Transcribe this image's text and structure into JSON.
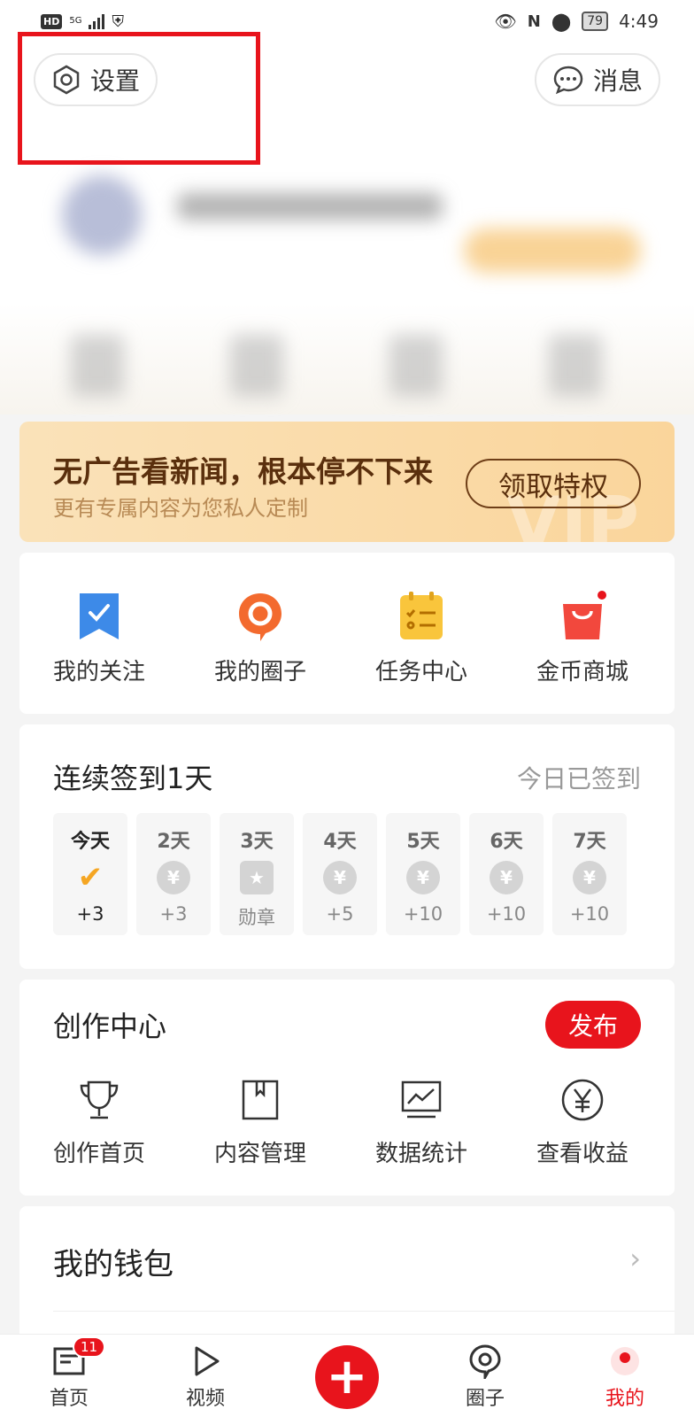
{
  "status_bar": {
    "left_badge": "HD",
    "network": "5G",
    "battery": "79",
    "time": "4:49"
  },
  "header": {
    "settings_label": "设置",
    "messages_label": "消息"
  },
  "vip_banner": {
    "title": "无广告看新闻，根本停不下来",
    "subtitle": "更有专属内容为您私人定制",
    "button": "领取特权",
    "watermark": "VIP"
  },
  "quick_actions": [
    {
      "label": "我的关注",
      "icon": "bookmark-icon"
    },
    {
      "label": "我的圈子",
      "icon": "circle-chat-icon"
    },
    {
      "label": "任务中心",
      "icon": "task-clipboard-icon"
    },
    {
      "label": "金币商城",
      "icon": "shopping-bag-icon"
    }
  ],
  "signin": {
    "title": "连续签到1天",
    "status": "今日已签到",
    "days": [
      {
        "label": "今天",
        "reward": "+3",
        "icon": "check-icon"
      },
      {
        "label": "2天",
        "reward": "+3",
        "icon": "coin-icon"
      },
      {
        "label": "3天",
        "reward": "勋章",
        "icon": "medal-icon"
      },
      {
        "label": "4天",
        "reward": "+5",
        "icon": "coin-icon"
      },
      {
        "label": "5天",
        "reward": "+10",
        "icon": "coin-icon"
      },
      {
        "label": "6天",
        "reward": "+10",
        "icon": "coin-icon"
      },
      {
        "label": "7天",
        "reward": "+10",
        "icon": "coin-icon"
      }
    ]
  },
  "creation": {
    "title": "创作中心",
    "publish": "发布",
    "items": [
      {
        "label": "创作首页",
        "icon": "trophy-icon"
      },
      {
        "label": "内容管理",
        "icon": "book-icon"
      },
      {
        "label": "数据统计",
        "icon": "chart-icon"
      },
      {
        "label": "查看收益",
        "icon": "yen-icon"
      }
    ]
  },
  "wallet": {
    "title": "我的钱包",
    "arrow": "›"
  },
  "bottom_nav": {
    "items": [
      {
        "label": "首页",
        "icon": "news-icon",
        "badge": "11"
      },
      {
        "label": "视频",
        "icon": "play-icon"
      },
      {
        "label": "",
        "icon": "plus-icon"
      },
      {
        "label": "圈子",
        "icon": "circle-icon"
      },
      {
        "label": "我的",
        "icon": "profile-icon"
      }
    ]
  },
  "colors": {
    "accent": "#e8141c",
    "vip_gold": "#fad59b",
    "vip_text": "#5a2f0d"
  }
}
